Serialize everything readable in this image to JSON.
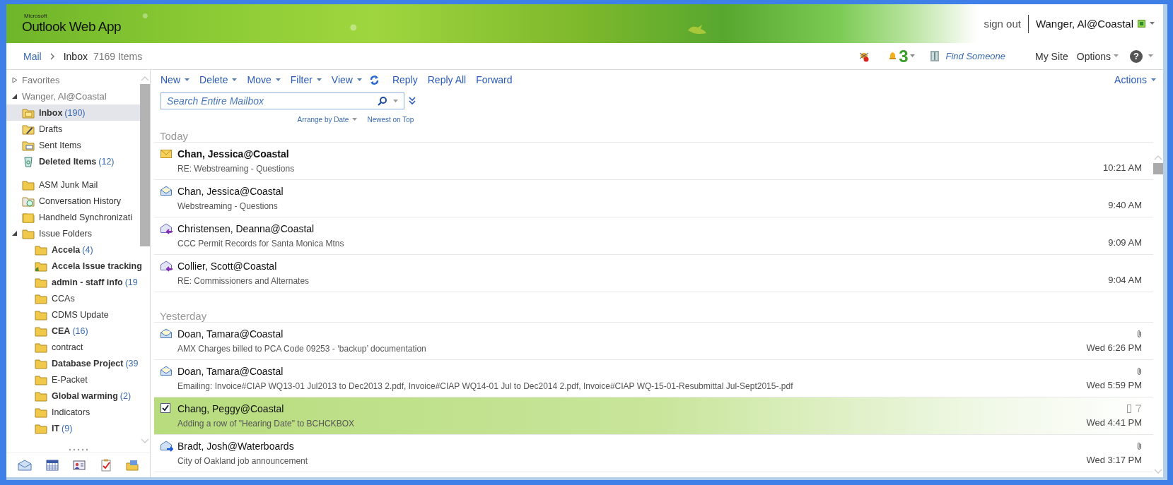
{
  "header": {
    "logo_small": "Microsoft",
    "logo": "Outlook Web App",
    "sign_out": "sign out",
    "user": "Wanger, Al@Coastal"
  },
  "breadcrumb": {
    "root": "Mail",
    "folder": "Inbox",
    "count": "7169 Items"
  },
  "top_links": {
    "reminders": "3",
    "find_someone": "Find Someone",
    "my_site": "My Site",
    "options": "Options",
    "help": "?"
  },
  "sidebar": {
    "favorites": {
      "label": "Favorites",
      "expanded": false
    },
    "mailbox": {
      "label": "Wanger, Al@Coastal",
      "expanded": true,
      "default_folders": [
        {
          "label": "Inbox",
          "count": "(190)",
          "unread": true,
          "selected": true,
          "kind": "inbox"
        },
        {
          "label": "Drafts",
          "unread": false,
          "selected": false,
          "kind": "drafts"
        },
        {
          "label": "Sent Items",
          "unread": false,
          "selected": false,
          "kind": "sent"
        },
        {
          "label": "Deleted Items",
          "count": "(12)",
          "unread": true,
          "selected": false,
          "kind": "deleted"
        }
      ],
      "folders": [
        {
          "label": "ASM Junk Mail",
          "unread": false,
          "selected": false,
          "kind": "folder"
        },
        {
          "label": "Conversation History",
          "unread": false,
          "selected": false,
          "kind": "history"
        },
        {
          "label": "Handheld Synchronizati",
          "unread": false,
          "selected": false,
          "kind": "handheld"
        },
        {
          "label": "Issue Folders",
          "unread": false,
          "selected": false,
          "kind": "folder",
          "expanded": true,
          "children": [
            {
              "label": "Accela",
              "count": "(4)",
              "unread": true,
              "selected": false,
              "kind": "folder"
            },
            {
              "label": "Accela Issue tracking",
              "unread": true,
              "selected": false,
              "kind": "shared"
            },
            {
              "label": "admin - staff info",
              "count": "(19",
              "unread": true,
              "selected": false,
              "kind": "folder"
            },
            {
              "label": "CCAs",
              "unread": false,
              "selected": false,
              "kind": "folder"
            },
            {
              "label": "CDMS Update",
              "unread": false,
              "selected": false,
              "kind": "folder"
            },
            {
              "label": "CEA",
              "count": "(16)",
              "unread": true,
              "selected": false,
              "kind": "folder"
            },
            {
              "label": "contract",
              "unread": false,
              "selected": false,
              "kind": "folder"
            },
            {
              "label": "Database Project",
              "count": "(39",
              "unread": true,
              "selected": false,
              "kind": "folder"
            },
            {
              "label": "E-Packet",
              "unread": false,
              "selected": false,
              "kind": "folder"
            },
            {
              "label": "Global warming",
              "count": "(2)",
              "unread": true,
              "selected": false,
              "kind": "folder"
            },
            {
              "label": "Indicators",
              "unread": false,
              "selected": false,
              "kind": "folder"
            },
            {
              "label": "IT",
              "count": "(9)",
              "unread": true,
              "selected": false,
              "kind": "folder"
            }
          ]
        }
      ]
    }
  },
  "toolbar": {
    "buttons": [
      {
        "label": "New",
        "dropdown": true
      },
      {
        "label": "Delete",
        "dropdown": true
      },
      {
        "label": "Move",
        "dropdown": true
      },
      {
        "label": "Filter",
        "dropdown": true
      },
      {
        "label": "View",
        "dropdown": true
      },
      {
        "label": "Reply",
        "dropdown": false
      },
      {
        "label": "Reply All",
        "dropdown": false
      },
      {
        "label": "Forward",
        "dropdown": false
      }
    ],
    "actions": "Actions"
  },
  "search": {
    "placeholder": "Search Entire Mailbox"
  },
  "arrange": {
    "by": "Arrange by Date",
    "order": "Newest on Top"
  },
  "groups": [
    {
      "label": "Today",
      "messages": [
        {
          "sender": "Chan, Jessica@Coastal",
          "subject": "RE: Webstreaming - Questions",
          "time": "10:21 AM",
          "unread": true,
          "selected": false,
          "kind": "unread",
          "attachment": false
        },
        {
          "sender": "Chan, Jessica@Coastal",
          "subject": "Webstreaming - Questions",
          "time": "9:40 AM",
          "unread": false,
          "selected": false,
          "kind": "read",
          "attachment": false
        },
        {
          "sender": "Christensen, Deanna@Coastal",
          "subject": "CCC Permit Records for Santa Monica Mtns",
          "time": "9:09 AM",
          "unread": false,
          "selected": false,
          "kind": "replied",
          "attachment": false
        },
        {
          "sender": "Collier, Scott@Coastal",
          "subject": "RE: Commissioners and Alternates",
          "time": "9:04 AM",
          "unread": false,
          "selected": false,
          "kind": "replied",
          "attachment": false
        }
      ]
    },
    {
      "label": "Yesterday",
      "messages": [
        {
          "sender": "Doan, Tamara@Coastal",
          "subject": "AMX Charges billed to PCA Code 09253 - ‘backup’ documentation",
          "time": "Wed 6:26 PM",
          "unread": false,
          "selected": false,
          "kind": "read",
          "attachment": true
        },
        {
          "sender": "Doan, Tamara@Coastal",
          "subject": "Emailing: Invoice#CIAP WQ13-01 Jul2013 to Dec2013 2.pdf, Invoice#CIAP WQ14-01 Jul to Dec2014 2.pdf, Invoice#CIAP WQ-15-01-Resubmittal Jul-Sept2015-.pdf",
          "time": "Wed 5:59 PM",
          "unread": false,
          "selected": false,
          "kind": "read",
          "attachment": true
        },
        {
          "sender": "Chang, Peggy@Coastal",
          "subject": "Adding a row of \"Hearing Date\" to BCHCKBOX",
          "time": "Wed 4:41 PM",
          "unread": false,
          "selected": true,
          "attachment": false
        },
        {
          "sender": "Bradt, Josh@Waterboards",
          "subject": "City of Oakland job announcement",
          "time": "Wed 3:17 PM",
          "unread": false,
          "selected": false,
          "kind": "forwarded",
          "attachment": true
        }
      ]
    }
  ]
}
